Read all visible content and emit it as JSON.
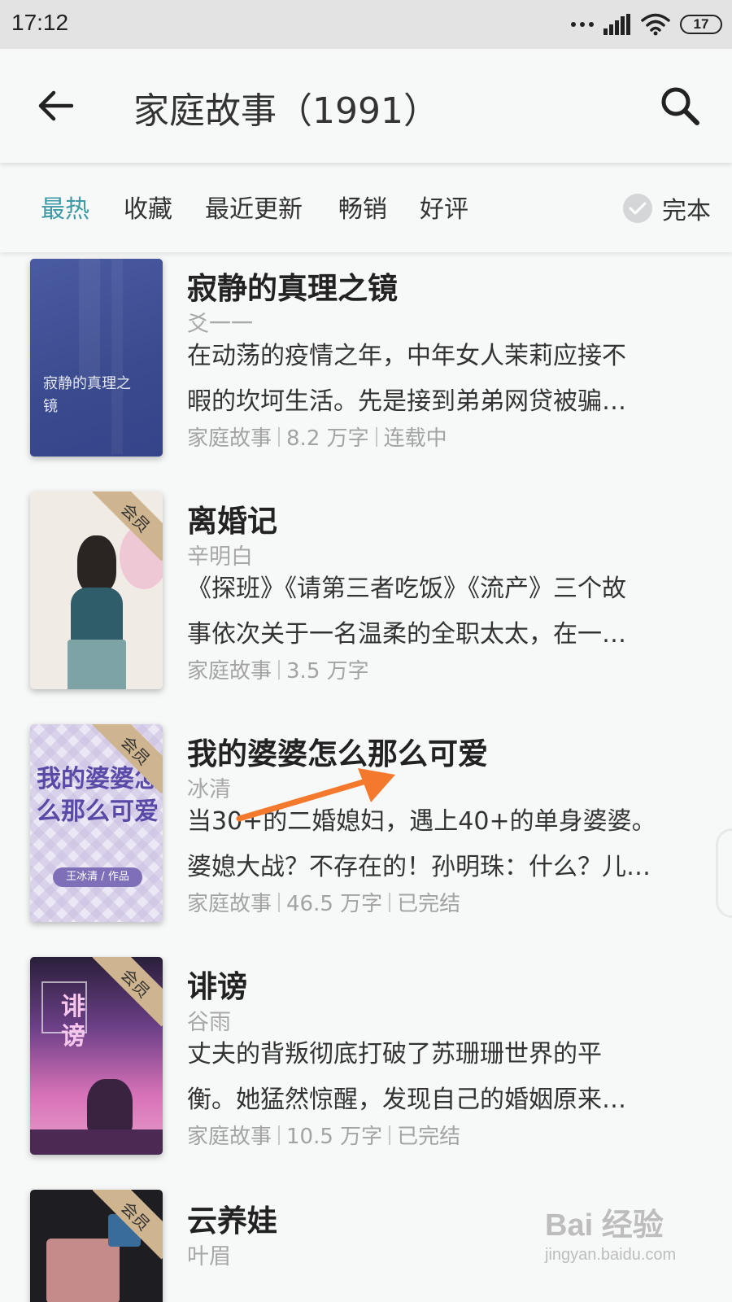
{
  "status_bar": {
    "time": "17:12",
    "battery": "17"
  },
  "app_bar": {
    "title": "家庭故事（1991）",
    "back_icon": "arrow-left-icon",
    "search_icon": "search-icon"
  },
  "filters": {
    "tabs": [
      {
        "label": "最热",
        "active": true
      },
      {
        "label": "收藏",
        "active": false
      },
      {
        "label": "最近更新",
        "active": false
      },
      {
        "label": "畅销",
        "active": false
      },
      {
        "label": "好评",
        "active": false
      }
    ],
    "full_text_toggle": {
      "label": "完本",
      "checked": false
    }
  },
  "books": [
    {
      "title": "寂静的真理之镜",
      "author": "爻一一",
      "desc_line1": "在动荡的疫情之年，中年女人茉莉应接不",
      "desc_line2": "暇的坎坷生活。先是接到弟弟网贷被骗…",
      "category": "家庭故事",
      "words": "8.2 万字",
      "status": "连载中",
      "vip": "",
      "cover_text": "寂静的真理之镜",
      "cover_color": "#3f4f95"
    },
    {
      "title": "离婚记",
      "author": "辛明白",
      "desc_line1": "《探班》《请第三者吃饭》《流产》三个故",
      "desc_line2": "事依次关于一名温柔的全职太太，在一…",
      "category": "家庭故事",
      "words": "3.5 万字",
      "status": "",
      "vip": "会员",
      "cover_color": "#f1ebe6"
    },
    {
      "title": "我的婆婆怎么那么可爱",
      "author": "冰清",
      "desc_line1": "当30+的二婚媳妇，遇上40+的单身婆婆。",
      "desc_line2": "婆媳大战？不存在的！孙明珠：什么？儿…",
      "category": "家庭故事",
      "words": "46.5 万字",
      "status": "已完结",
      "vip": "会员",
      "cover_text": "我的婆婆怎么那么可爱",
      "cover_byline": "王冰清 / 作品",
      "cover_color": "#ece7f4"
    },
    {
      "title": "诽谤",
      "author": "谷雨",
      "desc_line1": "丈夫的背叛彻底打破了苏珊珊世界的平",
      "desc_line2": "衡。她猛然惊醒，发现自己的婚姻原来…",
      "category": "家庭故事",
      "words": "10.5 万字",
      "status": "已完结",
      "vip": "会员",
      "cover_text": "诽谤",
      "cover_color": "#7a3e7a"
    },
    {
      "title": "云养娃",
      "author": "叶眉",
      "vip": "会员",
      "cover_color": "#1d1d22"
    }
  ],
  "overlay": {
    "annotation_arrow_color": "#f5792c"
  },
  "watermark": {
    "brand": "Bai 经验",
    "url": "jingyan.baidu.com"
  }
}
